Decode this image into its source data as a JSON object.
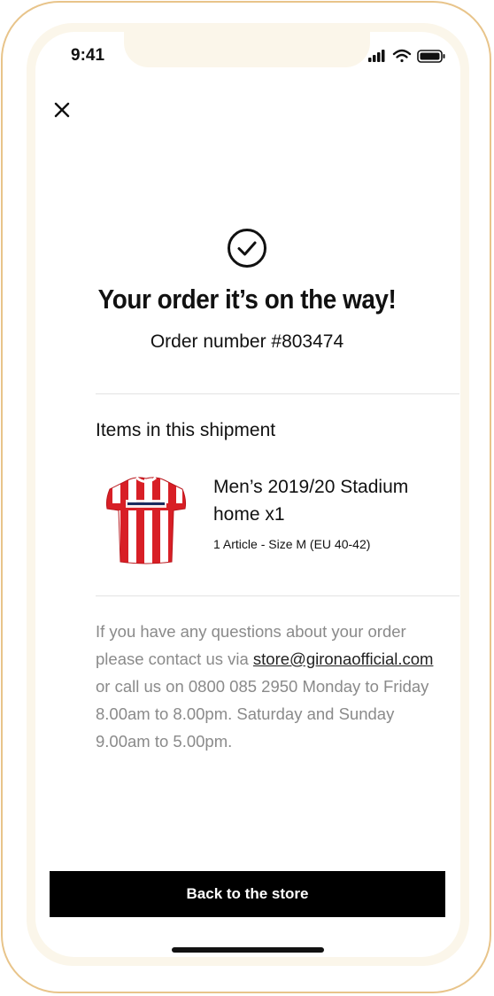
{
  "status_bar": {
    "time": "9:41"
  },
  "header": {
    "close_icon": "close-icon"
  },
  "confirmation": {
    "icon": "checkmark-circle-icon",
    "title": "Your order it’s on the way!",
    "order_number": "Order number #803474"
  },
  "shipment": {
    "heading": "Items in this shipment",
    "items": [
      {
        "name": "Men’s 2019/20 Stadium home x1",
        "detail": "1 Article - Size M (EU 40-42)",
        "image_icon": "football-shirt-icon"
      }
    ]
  },
  "contact": {
    "text_before": "If you have any questions about your order please contact us via ",
    "email": "store@gironaofficial.com",
    "text_after": " or call us on 0800 085 2950 Monday to Friday 8.00am to 8.00pm. Saturday and Sunday 9.00am to 5.00pm."
  },
  "footer": {
    "button_label": "Back to the store"
  },
  "colors": {
    "frame": "#e8c48a",
    "bezel": "#fbf6ea",
    "button_bg": "#000000",
    "shirt_red": "#d81f26"
  }
}
